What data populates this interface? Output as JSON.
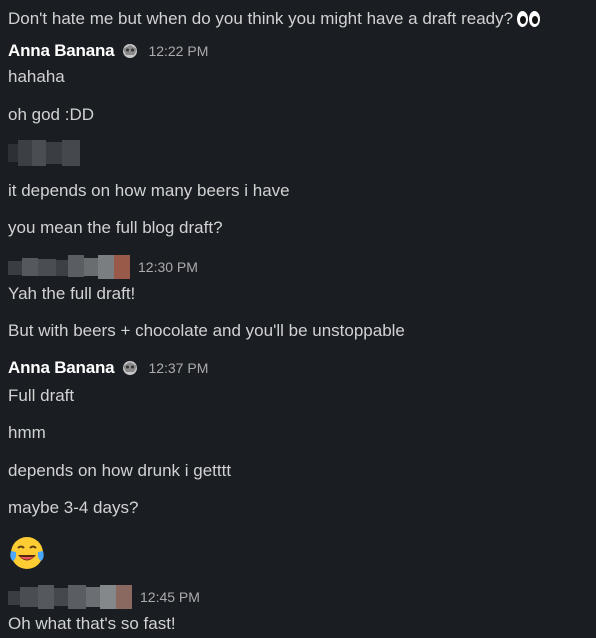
{
  "messages": {
    "top_line": "Don't hate me but when do you think you might have a draft ready?",
    "group1": {
      "author": "Anna Banana",
      "time": "12:22 PM",
      "lines": [
        "hahaha",
        "oh god :DD"
      ]
    },
    "group1b": {
      "lines": [
        "it depends on how many beers i have",
        "you mean the full blog draft?"
      ]
    },
    "group2": {
      "time": "12:30 PM",
      "lines": [
        "Yah the full draft!",
        "But with beers + chocolate and you'll be unstoppable"
      ]
    },
    "group3": {
      "author": "Anna Banana",
      "time": "12:37 PM",
      "lines": [
        "Full draft",
        "hmm",
        "depends on how drunk i getttt",
        "maybe 3-4 days?"
      ]
    },
    "group4": {
      "time": "12:45 PM",
      "lines": [
        "Oh what that's so fast!"
      ]
    }
  },
  "icons": {
    "eyes": "eyes-emoji-icon",
    "status": "status-emoji-icon",
    "joy": "face-with-tears-of-joy-icon",
    "redacted": "redacted-name-icon"
  },
  "colors": {
    "background": "#1a1d21",
    "text": "#d1d2d3",
    "author": "#ffffff",
    "timestamp": "#ababad"
  }
}
